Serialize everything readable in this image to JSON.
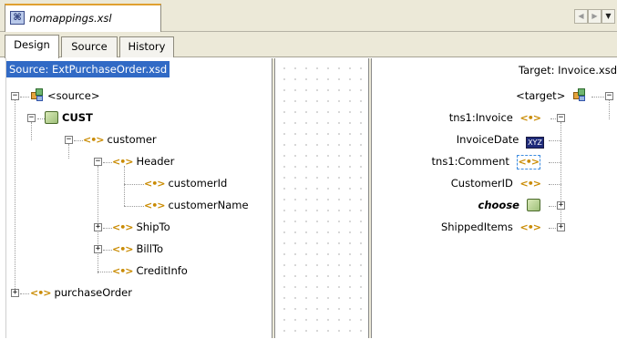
{
  "file_tab": {
    "icon": "xsl-file-icon",
    "name": "nomappings.xsl"
  },
  "view_tabs": [
    "Design",
    "Source",
    "History"
  ],
  "source_panel": {
    "header": "Source: ExtPurchaseOrder.xsd",
    "tree": [
      {
        "label": "<source>",
        "icon": "source-root-icon"
      },
      {
        "label": "CUST",
        "icon": "complex-type-icon"
      },
      {
        "label": "customer",
        "icon": "element-icon"
      },
      {
        "label": "Header",
        "icon": "element-icon"
      },
      {
        "label": "customerId",
        "icon": "element-icon"
      },
      {
        "label": "customerName",
        "icon": "element-icon"
      },
      {
        "label": "ShipTo",
        "icon": "element-icon"
      },
      {
        "label": "BillTo",
        "icon": "element-icon"
      },
      {
        "label": "CreditInfo",
        "icon": "element-icon"
      },
      {
        "label": "purchaseOrder",
        "icon": "element-icon"
      }
    ]
  },
  "target_panel": {
    "header": "Target: Invoice.xsd",
    "tree": [
      {
        "label": "<target>",
        "icon": "target-root-icon"
      },
      {
        "label": "tns1:Invoice",
        "icon": "element-icon"
      },
      {
        "label": "InvoiceDate",
        "icon": "xyz-function-icon",
        "icon_text": "XYZ"
      },
      {
        "label": "tns1:Comment",
        "icon": "element-icon"
      },
      {
        "label": "CustomerID",
        "icon": "element-icon"
      },
      {
        "label": "choose",
        "icon": "complex-type-icon"
      },
      {
        "label": "ShippedItems",
        "icon": "element-icon"
      }
    ]
  },
  "icons": {
    "element_glyph": "<•>",
    "expand_glyph": "+",
    "collapse_glyph": "−",
    "nav_prev": "◀",
    "nav_next": "▶",
    "nav_dropdown": "▼"
  },
  "colors": {
    "selection": "#316ac5",
    "element_icon": "#c98a00",
    "active_tab_top": "#e0a030"
  }
}
